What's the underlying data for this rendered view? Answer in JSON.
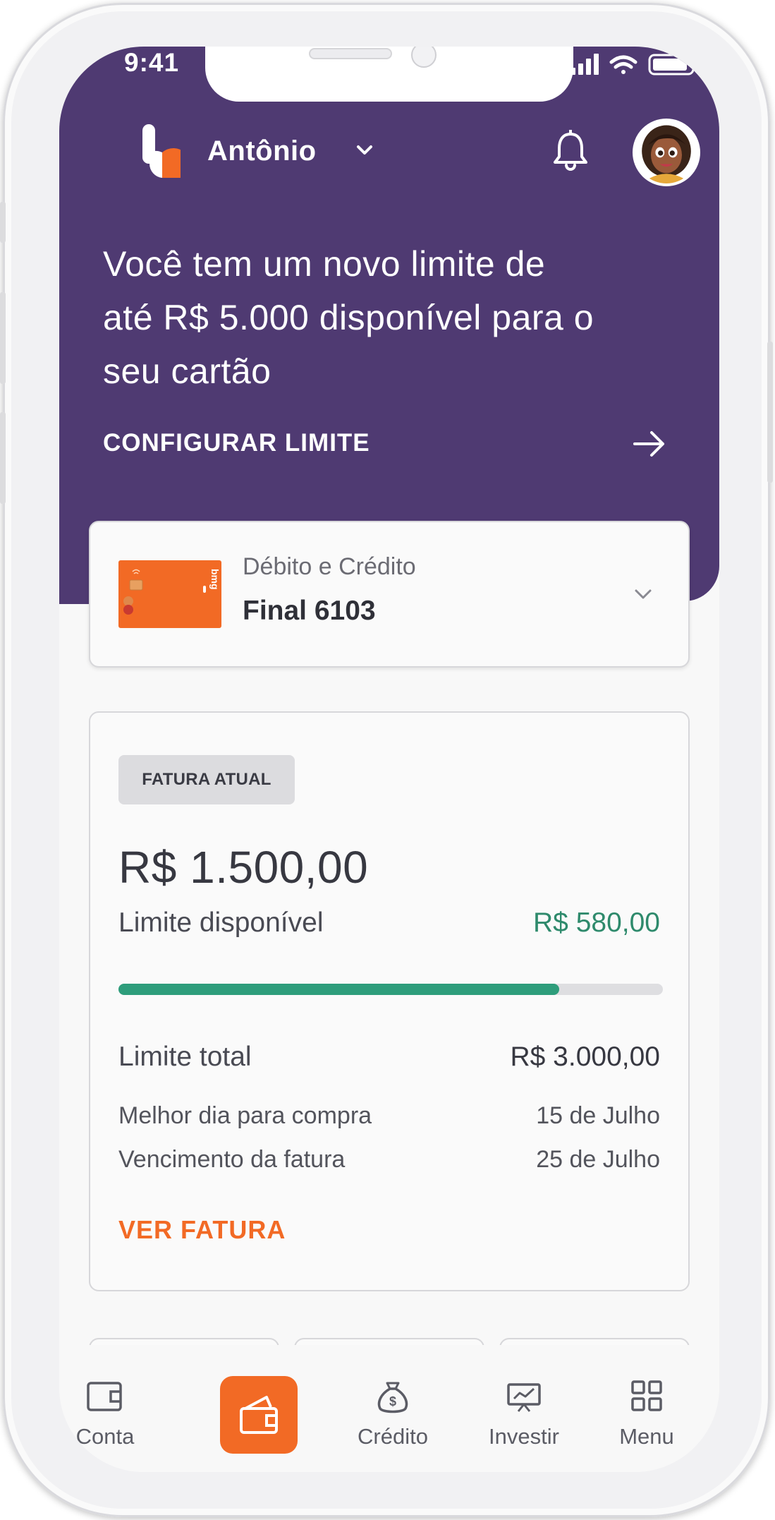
{
  "status_bar": {
    "time": "9:41"
  },
  "header": {
    "user_name": "Antônio",
    "notifications_icon": "bell-icon",
    "colors": {
      "brand_purple": "#4f3a72",
      "accent_orange": "#f26a25",
      "positive_green": "#2e9d7b"
    }
  },
  "promo": {
    "text_line1": "Você tem um novo limite de",
    "text_line2": "até R$ 5.000 disponível para o",
    "text_line3": "seu cartão",
    "action_label": "CONFIGURAR LIMITE"
  },
  "card_selector": {
    "type_label": "Débito e Crédito",
    "card_final": "Final 6103",
    "card_brand": "bmg"
  },
  "invoice": {
    "badge": "FATURA ATUAL",
    "amount": "R$ 1.500,00",
    "available_limit_label": "Limite disponível",
    "available_limit_value": "R$ 580,00",
    "limit_used_fraction": 0.81,
    "total_limit_label": "Limite total",
    "total_limit_value": "R$ 3.000,00",
    "best_day_label": "Melhor dia para compra",
    "best_day_value": "15 de Julho",
    "due_date_label": "Vencimento da fatura",
    "due_date_value": "25 de Julho",
    "action_label": "VER FATURA"
  },
  "bottom_nav": {
    "items": [
      {
        "label": "Conta",
        "icon": "wallet-icon"
      },
      {
        "label": "",
        "icon": "card-wallet-icon",
        "active": true
      },
      {
        "label": "Crédito",
        "icon": "money-bag-icon"
      },
      {
        "label": "Investir",
        "icon": "chart-board-icon"
      },
      {
        "label": "Menu",
        "icon": "grid-icon"
      }
    ]
  }
}
